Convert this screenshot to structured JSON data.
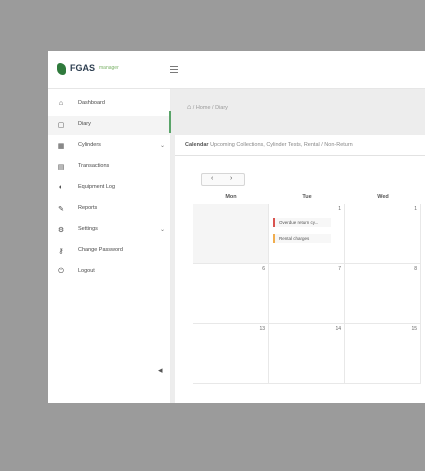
{
  "app": {
    "logo_text": "FGAS",
    "logo_sub": "manager"
  },
  "sidebar": {
    "items": [
      {
        "icon": "home-icon",
        "glyph": "⌂",
        "label": "Dashboard",
        "expandable": false
      },
      {
        "icon": "calendar-icon",
        "glyph": "▢",
        "label": "Diary",
        "expandable": false,
        "active": true
      },
      {
        "icon": "cylinder-icon",
        "glyph": "▦",
        "label": "Cylinders",
        "expandable": true
      },
      {
        "icon": "transactions-icon",
        "glyph": "▤",
        "label": "Transactions",
        "expandable": false
      },
      {
        "icon": "equipment-icon",
        "glyph": "◐",
        "label": "Equipment Log",
        "expandable": false
      },
      {
        "icon": "reports-icon",
        "glyph": "✎",
        "label": "Reports",
        "expandable": false
      },
      {
        "icon": "settings-icon",
        "glyph": "⚙",
        "label": "Settings",
        "expandable": true
      },
      {
        "icon": "key-icon",
        "glyph": "⚷",
        "label": "Change Password",
        "expandable": false
      },
      {
        "icon": "logout-icon",
        "glyph": "⏻",
        "label": "Logout",
        "expandable": false
      }
    ],
    "collapse_glyph": "◂"
  },
  "breadcrumb": {
    "home_glyph": "⌂",
    "items": [
      "Home",
      "Diary"
    ]
  },
  "calendar": {
    "title_bold": "Calendar",
    "title_rest": "Upcoming Collections, Cylinder Tests, Rental / Non-Return",
    "prev": "‹",
    "next": "›",
    "days": [
      "Mon",
      "Tue",
      "Wed"
    ],
    "weeks": [
      [
        "",
        "1",
        "1"
      ],
      [
        "6",
        "7",
        "8"
      ],
      [
        "13",
        "14",
        "15"
      ]
    ],
    "events": [
      {
        "label": "Overdue return cy...",
        "color": "red"
      },
      {
        "label": "Rental charges",
        "color": "orange"
      }
    ]
  }
}
